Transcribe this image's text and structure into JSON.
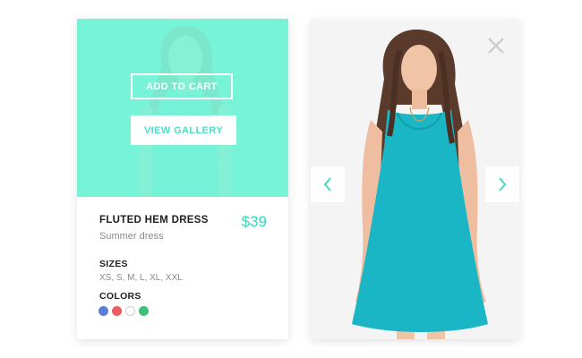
{
  "card": {
    "add_to_cart_label": "ADD TO CART",
    "view_gallery_label": "VIEW GALLERY",
    "product_title": "FLUTED HEM DRESS",
    "product_subtitle": "Summer dress",
    "price": "$39",
    "sizes_label": "SIZES",
    "sizes_value": "XS, S, M, L, XL, XXL",
    "colors_label": "COLORS",
    "swatches": [
      "#5b7fd8",
      "#ec5b62",
      "#ffffff",
      "#3fbf78"
    ]
  },
  "gallery": {
    "close_icon": "close-icon",
    "prev_icon": "chevron-left-icon",
    "next_icon": "chevron-right-icon"
  },
  "colors": {
    "accent": "#38d8b8",
    "overlay": "#84f8db",
    "dress": "#1ab6c6"
  }
}
